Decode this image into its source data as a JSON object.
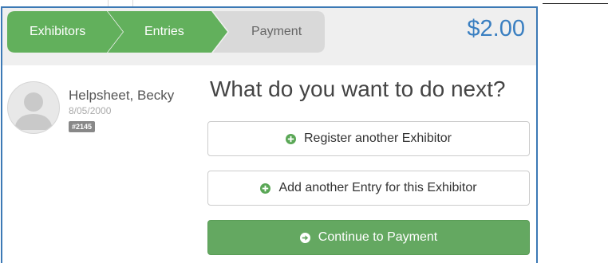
{
  "steps": [
    {
      "label": "Exhibitors",
      "state": "done"
    },
    {
      "label": "Entries",
      "state": "done"
    },
    {
      "label": "Payment",
      "state": "current"
    }
  ],
  "cart_total": "$2.00",
  "exhibitor": {
    "name": "Helpsheet, Becky",
    "birthdate": "8/05/2000",
    "id_badge": "#2145"
  },
  "prompt": "What do you want to do next?",
  "actions": {
    "register": "Register another Exhibitor",
    "add_entry": "Add another Entry for this Exhibitor",
    "continue": "Continue to Payment"
  },
  "colors": {
    "step_done": "#62b05c",
    "step_current": "#d9d9d9",
    "primary_button": "#64a861",
    "total_text": "#3a7fc1",
    "frame_border": "#3c79b5"
  },
  "icons": {
    "plus": "plus-circle-icon",
    "arrow": "arrow-right-circle-icon",
    "avatar": "user-placeholder-icon"
  }
}
